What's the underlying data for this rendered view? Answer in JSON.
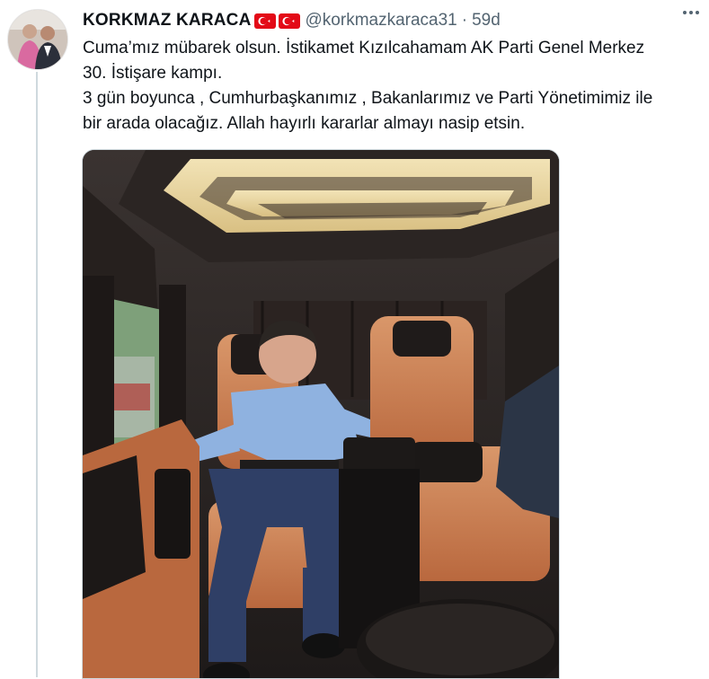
{
  "tweet": {
    "author_name": "KORKMAZ KARACA",
    "handle": "@korkmazkaraca31",
    "separator": "·",
    "time": "59d",
    "lines": [
      "Cuma’mız mübarek olsun. İstikamet Kızılcahamam AK Parti Genel Merkez",
      "30. İstişare kampı.",
      "3 gün boyunca , Cumhurbaşkanımız , Bakanlarımız ve Parti Yönetimimiz ile",
      "bir arada olacağız. Allah hayırlı kararlar almayı nasip etsin."
    ],
    "flags": [
      "turkey-flag",
      "turkey-flag"
    ],
    "more_icon": "more-horizontal-icon"
  },
  "colors": {
    "text": "#0f1419",
    "secondary": "#536471",
    "flag_red": "#e30a17",
    "divider": "#cfd9de"
  }
}
